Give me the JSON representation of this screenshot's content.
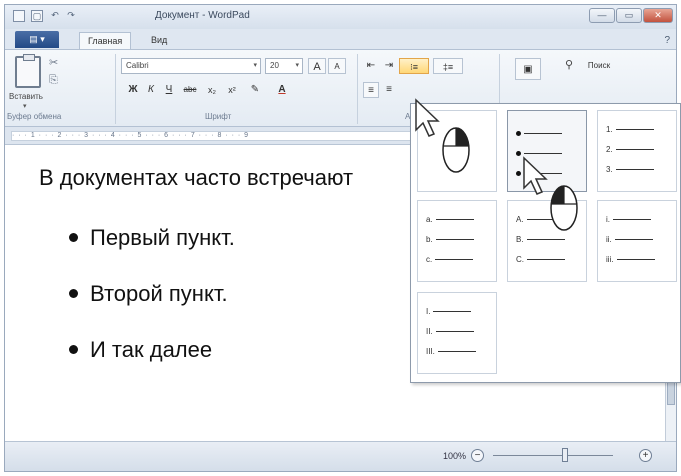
{
  "window": {
    "title": "Документ - WordPad",
    "quick_access": [
      "▢",
      "↶",
      "↷"
    ],
    "controls": {
      "minimize": "—",
      "maximize": "▭",
      "close": "✕"
    }
  },
  "tabs": {
    "file": "▤ ▾",
    "items": [
      "Главная",
      "Вид"
    ],
    "active": "Главная",
    "help": "?"
  },
  "ribbon": {
    "clipboard": {
      "paste_label": "Вставить",
      "paste_arrow": "▾",
      "cut_icon": "✂",
      "copy_icon": "⎘",
      "group_label": "Буфер обмена"
    },
    "font": {
      "font_name": "Calibri",
      "font_size": "20",
      "grow": "A",
      "shrink": "A",
      "bold": "Ж",
      "italic": "К",
      "underline": "Ч",
      "strike": "abc",
      "subscript": "x₂",
      "superscript": "x²",
      "highlight": "✎",
      "color": "A",
      "group_label": "Шрифт"
    },
    "paragraph": {
      "decrease_indent": "⇤",
      "increase_indent": "⇥",
      "bullets": "⁝≡",
      "line_spacing": "‡≡",
      "align_left": "≡",
      "align_center": "≡",
      "group_label": "А"
    },
    "editing": {
      "picture_icon": "▣",
      "find_label": "Поиск"
    }
  },
  "ruler": {
    "marks": "· · · 1 · · · 2 · · · 3 · · · 4 · · · 5 · · · 6 · · · 7 · · · 8 · · · 9"
  },
  "document": {
    "intro": "В документах часто встречают",
    "bullets": [
      "Первый пункт.",
      "Второй пункт.",
      "И так далее"
    ]
  },
  "status_bar": {
    "zoom": "100%",
    "zoom_level": 1.0,
    "zoom_minus": "−",
    "zoom_plus": "+"
  },
  "bullet_library": {
    "options": [
      {
        "kind": "none",
        "markers": []
      },
      {
        "kind": "dots",
        "markers": [
          "•",
          "•",
          "•"
        ]
      },
      {
        "kind": "numbers",
        "markers": [
          "1.",
          "2.",
          "3."
        ]
      },
      {
        "kind": "lower-alpha",
        "markers": [
          "a.",
          "b.",
          "c."
        ]
      },
      {
        "kind": "upper-alpha",
        "markers": [
          "A.",
          "B.",
          "C."
        ]
      },
      {
        "kind": "lower-roman",
        "markers": [
          "i.",
          "ii.",
          "iii."
        ]
      },
      {
        "kind": "upper-roman",
        "markers": [
          "I.",
          "II.",
          "III."
        ]
      }
    ],
    "selected_index": 1
  },
  "colors": {
    "accent": "#2c5597",
    "highlight": "#ffd777",
    "selection_border": "#8a97a8"
  }
}
